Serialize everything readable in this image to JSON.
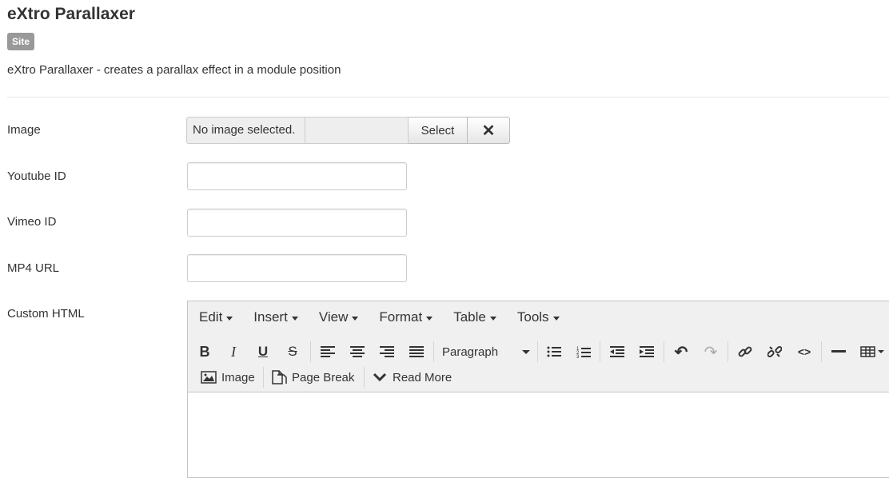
{
  "header": {
    "title": "eXtro Parallaxer",
    "badge": "Site",
    "description": "eXtro Parallaxer - creates a parallax effect in a module position"
  },
  "fields": {
    "image": {
      "label": "Image",
      "preview_text": "No image selected.",
      "select_label": "Select",
      "clear_icon": "close-icon",
      "clear_glyph": "✕"
    },
    "youtube": {
      "label": "Youtube ID",
      "value": ""
    },
    "vimeo": {
      "label": "Vimeo ID",
      "value": ""
    },
    "mp4": {
      "label": "MP4 URL",
      "value": ""
    },
    "custom_html": {
      "label": "Custom HTML"
    }
  },
  "editor": {
    "menus": [
      "Edit",
      "Insert",
      "View",
      "Format",
      "Table",
      "Tools"
    ],
    "format_select": "Paragraph",
    "buttons_row1": [
      "bold-icon",
      "italic-icon",
      "underline-icon",
      "strikethrough-icon",
      "align-left-icon",
      "align-center-icon",
      "align-right-icon",
      "align-justify-icon",
      "bullet-list-icon",
      "numbered-list-icon",
      "outdent-icon",
      "indent-icon",
      "undo-icon",
      "redo-icon",
      "link-icon",
      "unlink-icon",
      "code-icon",
      "horizontal-rule-icon",
      "table-icon"
    ],
    "row2": {
      "image_label": "Image",
      "pagebreak_label": "Page Break",
      "readmore_label": "Read More"
    }
  }
}
